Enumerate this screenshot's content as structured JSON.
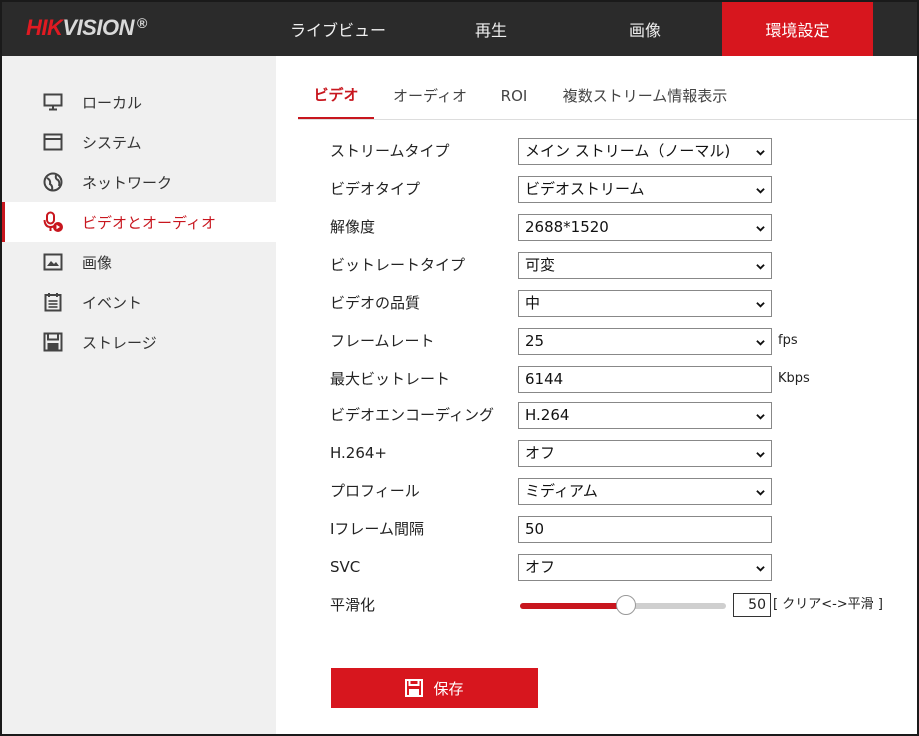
{
  "brand": {
    "hik": "HIK",
    "vision": "VISION",
    "reg": "®"
  },
  "nav": [
    {
      "label": "ライブビュー"
    },
    {
      "label": "再生"
    },
    {
      "label": "画像"
    },
    {
      "label": "環境設定"
    }
  ],
  "sidebar": {
    "items": [
      {
        "label": "ローカル",
        "icon": "monitor-icon"
      },
      {
        "label": "システム",
        "icon": "system-icon"
      },
      {
        "label": "ネットワーク",
        "icon": "globe-icon"
      },
      {
        "label": "ビデオとオーディオ",
        "icon": "microphone-icon"
      },
      {
        "label": "画像",
        "icon": "image-icon"
      },
      {
        "label": "イベント",
        "icon": "calendar-icon"
      },
      {
        "label": "ストレージ",
        "icon": "save-disk-icon"
      }
    ],
    "active": "ビデオとオーディオ"
  },
  "tabs": [
    {
      "label": "ビデオ"
    },
    {
      "label": "オーディオ"
    },
    {
      "label": "ROI"
    },
    {
      "label": "複数ストリーム情報表示"
    }
  ],
  "form": {
    "stream_type": {
      "label": "ストリームタイプ",
      "value": "メイン ストリーム（ノーマル)"
    },
    "video_type": {
      "label": "ビデオタイプ",
      "value": "ビデオストリーム"
    },
    "resolution": {
      "label": "解像度",
      "value": "2688*1520"
    },
    "bitrate_type": {
      "label": "ビットレートタイプ",
      "value": "可変"
    },
    "video_quality": {
      "label": "ビデオの品質",
      "value": "中"
    },
    "frame_rate": {
      "label": "フレームレート",
      "value": "25",
      "unit": "fps"
    },
    "max_bitrate": {
      "label": "最大ビットレート",
      "value": "6144",
      "unit": "Kbps"
    },
    "video_encoding": {
      "label": "ビデオエンコーディング",
      "value": "H.264"
    },
    "h264plus": {
      "label": "H.264+",
      "value": "オフ"
    },
    "profile": {
      "label": "プロフィール",
      "value": "ミディアム"
    },
    "i_frame_interval": {
      "label": "Iフレーム間隔",
      "value": "50"
    },
    "svc": {
      "label": "SVC",
      "value": "オフ"
    },
    "smoothing": {
      "label": "平滑化",
      "value": "50",
      "level": 0.5,
      "hint": "[ クリア<->平滑 ]"
    }
  },
  "save": {
    "label": "保存"
  },
  "colors": {
    "accent": "#d7161e",
    "topbar": "#2b2b2b",
    "sidebar": "#f0f0f0"
  }
}
